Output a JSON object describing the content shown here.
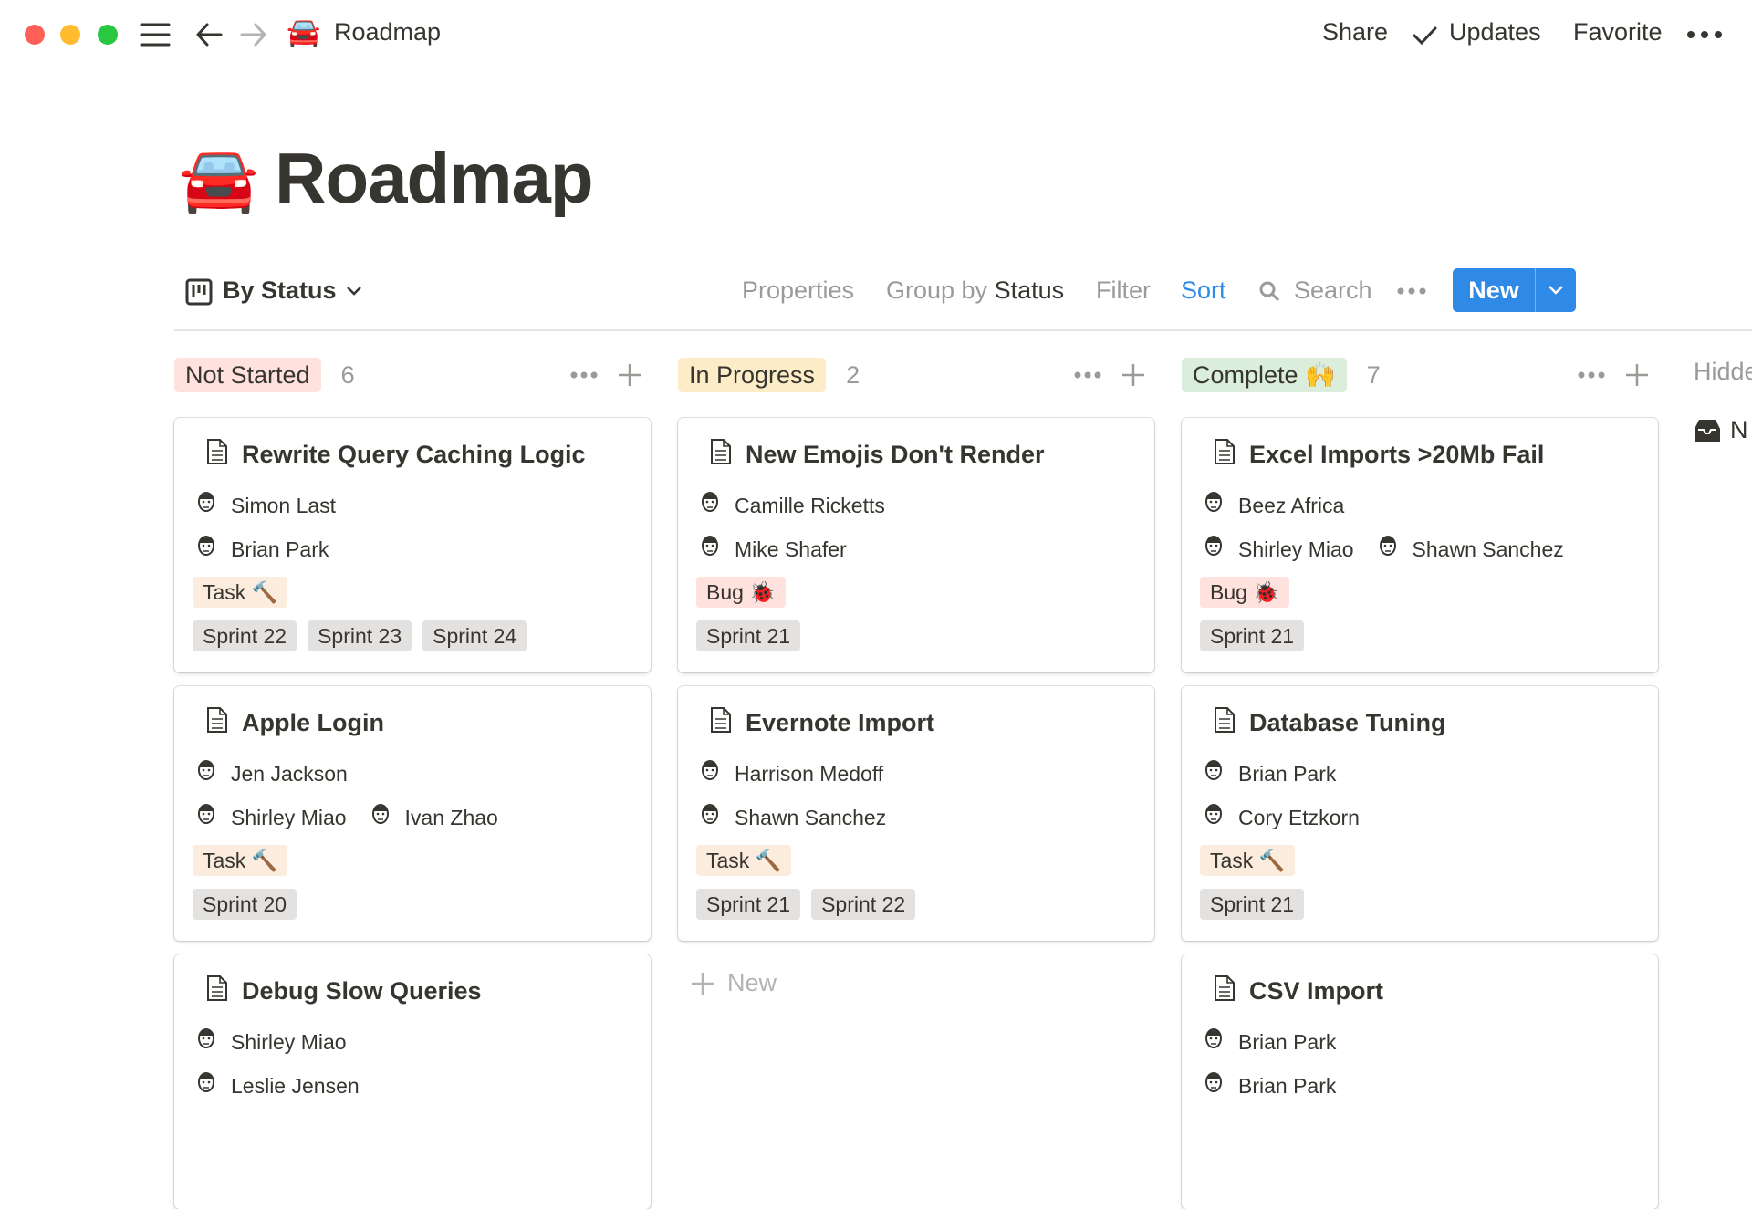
{
  "window": {
    "breadcrumb_emoji": "🚘",
    "breadcrumb_title": "Roadmap",
    "share_label": "Share",
    "updates_label": "Updates",
    "favorite_label": "Favorite"
  },
  "page": {
    "emoji": "🚘",
    "title": "Roadmap"
  },
  "toolbar": {
    "view_label": "By Status",
    "properties_label": "Properties",
    "group_by_prefix": "Group by",
    "group_by_value": "Status",
    "filter_label": "Filter",
    "sort_label": "Sort",
    "search_label": "Search",
    "new_label": "New",
    "sort_color": "#2e8ae6"
  },
  "columns": [
    {
      "label": "Not Started",
      "count": "6",
      "color": "#ffe2dd",
      "cards": [
        {
          "title": "Rewrite Query Caching Logic",
          "people": [
            [
              "Simon Last"
            ],
            [
              "Brian Park"
            ]
          ],
          "type": "Task 🔨",
          "type_color": "#fbecdd",
          "sprints": [
            "Sprint 22",
            "Sprint 23",
            "Sprint 24"
          ]
        },
        {
          "title": "Apple Login",
          "people": [
            [
              "Jen Jackson"
            ],
            [
              "Shirley Miao",
              "Ivan Zhao"
            ]
          ],
          "type": "Task 🔨",
          "type_color": "#fbecdd",
          "sprints": [
            "Sprint 20"
          ]
        },
        {
          "title": "Debug Slow Queries",
          "people": [
            [
              "Shirley Miao"
            ],
            [
              "Leslie Jensen"
            ]
          ],
          "type": "",
          "type_color": "",
          "sprints": []
        }
      ]
    },
    {
      "label": "In Progress",
      "count": "2",
      "color": "#fdecc8",
      "new_label": "New",
      "cards": [
        {
          "title": "New Emojis Don't Render",
          "people": [
            [
              "Camille Ricketts"
            ],
            [
              "Mike Shafer"
            ]
          ],
          "type": "Bug 🐞",
          "type_color": "#ffe2dd",
          "sprints": [
            "Sprint 21"
          ]
        },
        {
          "title": "Evernote Import",
          "people": [
            [
              "Harrison Medoff"
            ],
            [
              "Shawn Sanchez"
            ]
          ],
          "type": "Task 🔨",
          "type_color": "#fbecdd",
          "sprints": [
            "Sprint 21",
            "Sprint 22"
          ]
        }
      ]
    },
    {
      "label": "Complete 🙌",
      "count": "7",
      "color": "#dbeddb",
      "cards": [
        {
          "title": "Excel Imports >20Mb Fail",
          "people": [
            [
              "Beez Africa"
            ],
            [
              "Shirley Miao",
              "Shawn Sanchez"
            ]
          ],
          "type": "Bug 🐞",
          "type_color": "#ffe2dd",
          "sprints": [
            "Sprint 21"
          ]
        },
        {
          "title": "Database Tuning",
          "people": [
            [
              "Brian Park"
            ],
            [
              "Cory Etzkorn"
            ]
          ],
          "type": "Task 🔨",
          "type_color": "#fbecdd",
          "sprints": [
            "Sprint 21"
          ]
        },
        {
          "title": "CSV Import",
          "people": [
            [
              "Brian Park"
            ],
            [
              "Brian Park"
            ]
          ],
          "type": "",
          "type_color": "",
          "sprints": []
        }
      ]
    }
  ],
  "hidden": {
    "label": "Hidde",
    "item_label": "N"
  }
}
